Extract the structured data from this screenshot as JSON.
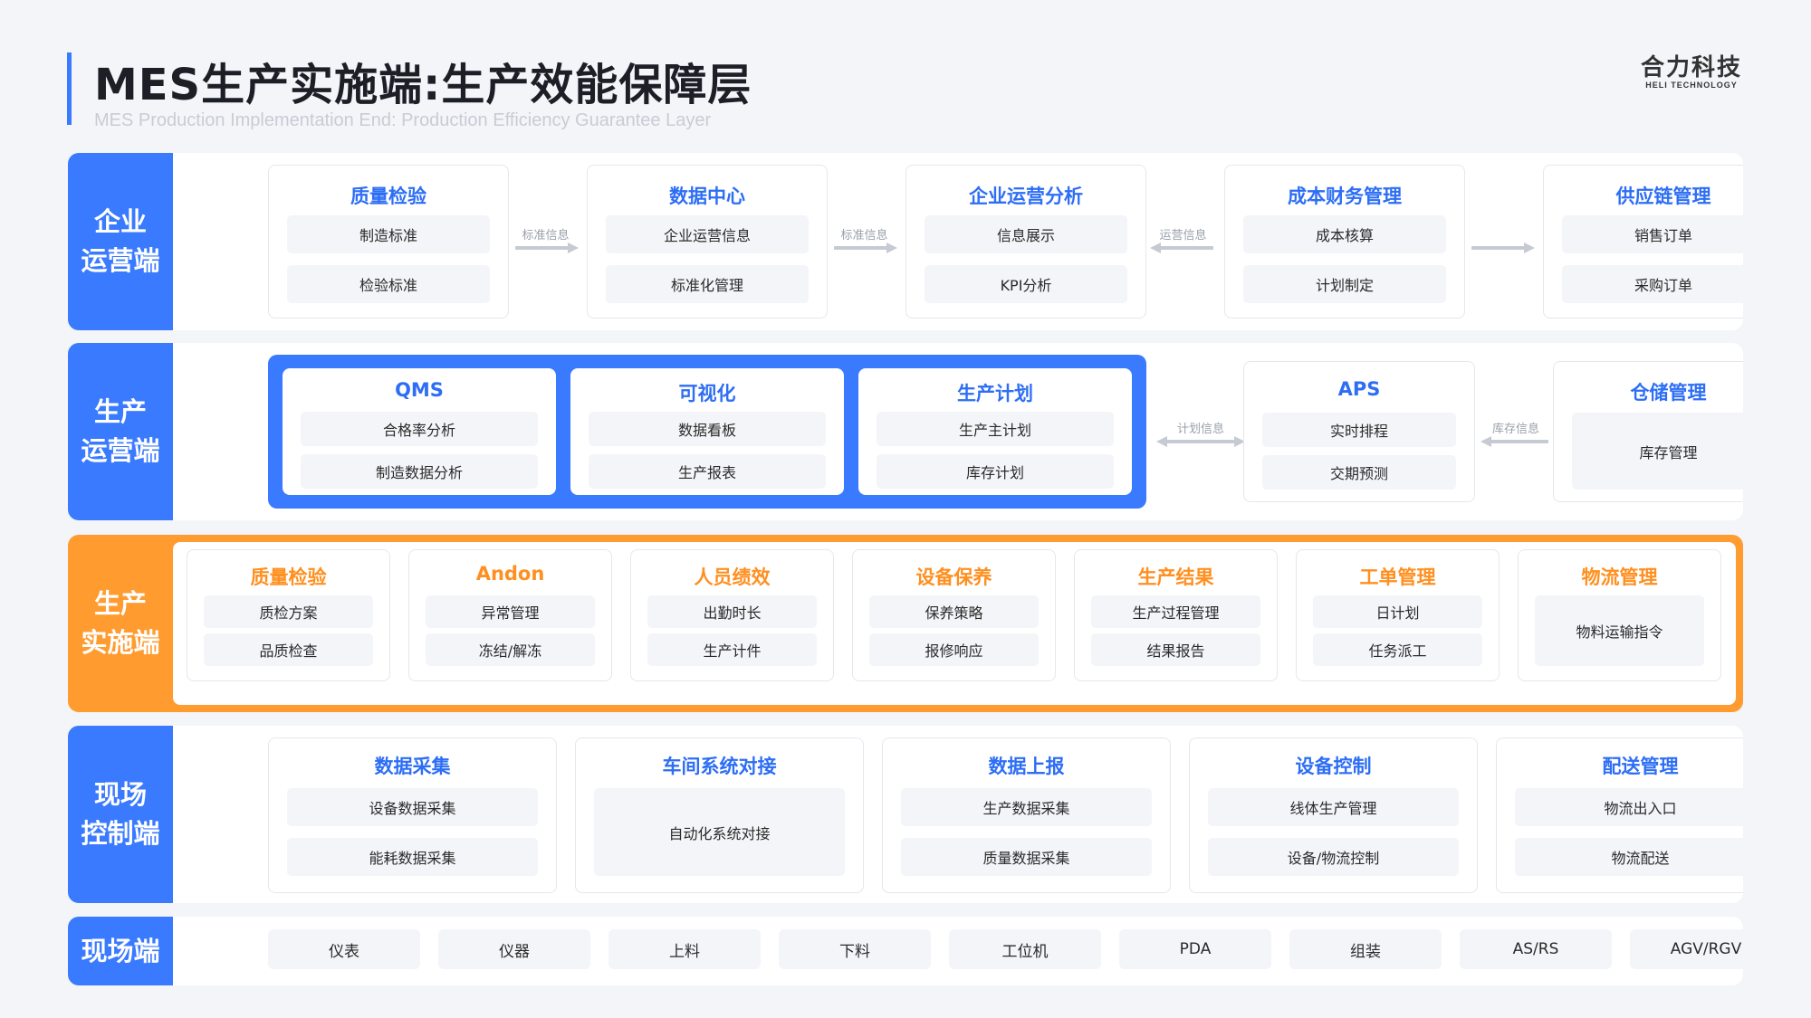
{
  "header": {
    "title": "MES生产实施端:生产效能保障层",
    "subtitle": "MES Production Implementation End: Production Efficiency Guarantee Layer",
    "logo_cn": "合力科技",
    "logo_en": "HELI TECHNOLOGY"
  },
  "layers": {
    "enterprise": {
      "label": [
        "企业",
        "运营端"
      ],
      "cards": [
        {
          "title": "质量检验",
          "items": [
            "制造标准",
            "检验标准"
          ]
        },
        {
          "title": "数据中心",
          "items": [
            "企业运营信息",
            "标准化管理"
          ]
        },
        {
          "title": "企业运营分析",
          "items": [
            "信息展示",
            "KPI分析"
          ]
        },
        {
          "title": "成本财务管理",
          "items": [
            "成本核算",
            "计划制定"
          ]
        },
        {
          "title": "供应链管理",
          "items": [
            "销售订单",
            "采购订单"
          ]
        }
      ],
      "arrows": [
        "标准信息",
        "标准信息",
        "运营信息",
        ""
      ]
    },
    "production_ops": {
      "label": [
        "生产",
        "运营端"
      ],
      "cards": [
        {
          "title": "QMS",
          "items": [
            "合格率分析",
            "制造数据分析"
          ]
        },
        {
          "title": "可视化",
          "items": [
            "数据看板",
            "生产报表"
          ]
        },
        {
          "title": "生产计划",
          "items": [
            "生产主计划",
            "库存计划"
          ]
        },
        {
          "title": "APS",
          "items": [
            "实时排程",
            "交期预测"
          ]
        },
        {
          "title": "仓储管理",
          "items": [
            "库存管理"
          ]
        }
      ],
      "arrows": [
        "计划信息",
        "库存信息"
      ]
    },
    "implementation": {
      "label": [
        "生产",
        "实施端"
      ],
      "cards": [
        {
          "title": "质量检验",
          "items": [
            "质检方案",
            "品质检查"
          ]
        },
        {
          "title": "Andon",
          "items": [
            "异常管理",
            "冻结/解冻"
          ]
        },
        {
          "title": "人员绩效",
          "items": [
            "出勤时长",
            "生产计件"
          ]
        },
        {
          "title": "设备保养",
          "items": [
            "保养策略",
            "报修响应"
          ]
        },
        {
          "title": "生产结果",
          "items": [
            "生产过程管理",
            "结果报告"
          ]
        },
        {
          "title": "工单管理",
          "items": [
            "日计划",
            "任务派工"
          ]
        },
        {
          "title": "物流管理",
          "items": [
            "物料运输指令"
          ]
        }
      ]
    },
    "site_control": {
      "label": [
        "现场",
        "控制端"
      ],
      "cards": [
        {
          "title": "数据采集",
          "items": [
            "设备数据采集",
            "能耗数据采集"
          ]
        },
        {
          "title": "车间系统对接",
          "items": [
            "自动化系统对接"
          ]
        },
        {
          "title": "数据上报",
          "items": [
            "生产数据采集",
            "质量数据采集"
          ]
        },
        {
          "title": "设备控制",
          "items": [
            "线体生产管理",
            "设备/物流控制"
          ]
        },
        {
          "title": "配送管理",
          "items": [
            "物流出入口",
            "物流配送"
          ]
        }
      ]
    },
    "field": {
      "label": "现场端",
      "items": [
        "仪表",
        "仪器",
        "上料",
        "下料",
        "工位机",
        "PDA",
        "组装",
        "AS/RS",
        "AGV/RGV"
      ]
    }
  },
  "colors": {
    "primary_blue": "#3a7afe",
    "accent_orange": "#ff9b2f",
    "title_blue": "#2d6ef5",
    "title_orange": "#ff8f1f"
  }
}
